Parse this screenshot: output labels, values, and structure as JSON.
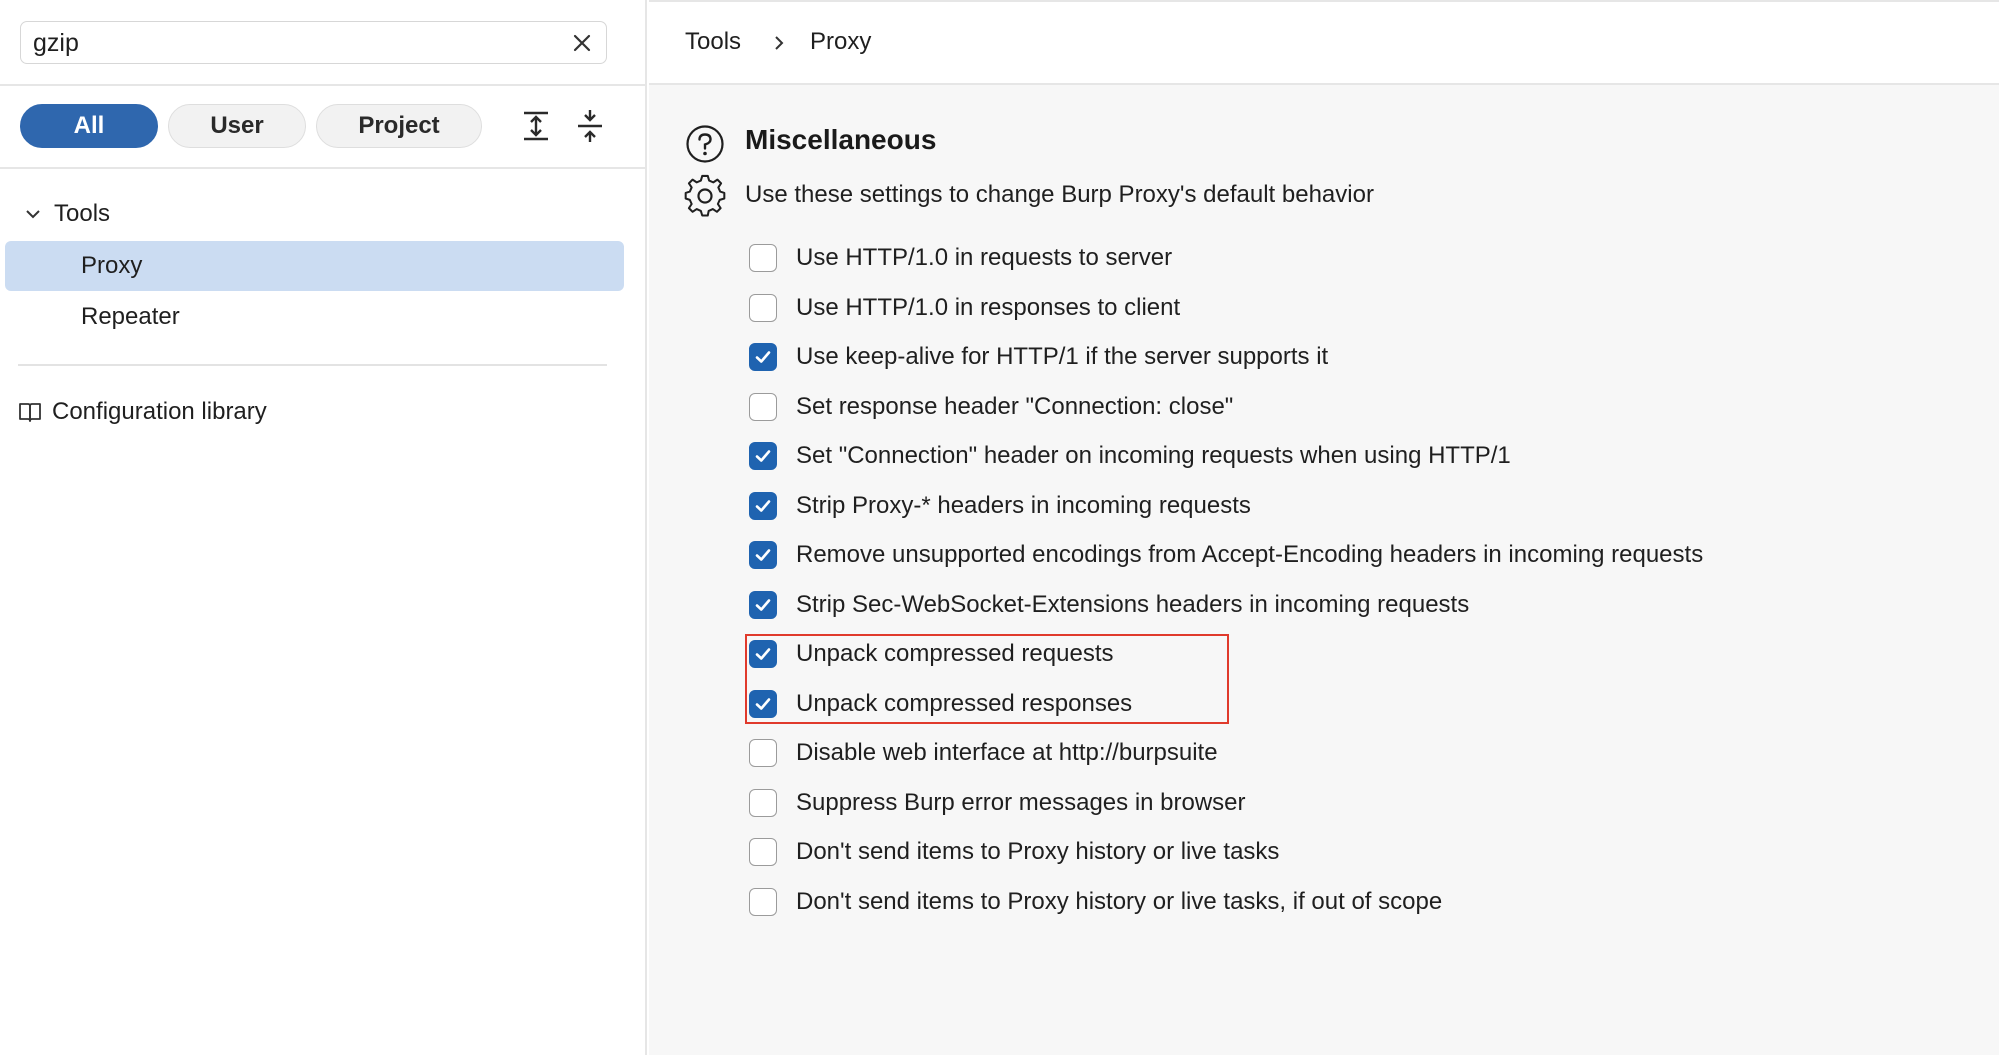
{
  "search": {
    "value": "gzip",
    "clear_icon": "close-icon"
  },
  "filters": {
    "all_label": "All",
    "user_label": "User",
    "project_label": "Project",
    "active": "All",
    "expand_icon": "expand-all-icon",
    "collapse_icon": "collapse-all-icon"
  },
  "tree": {
    "group_label": "Tools",
    "items": [
      {
        "label": "Proxy",
        "selected": true
      },
      {
        "label": "Repeater",
        "selected": false
      }
    ],
    "config_library_label": "Configuration library"
  },
  "breadcrumb": {
    "items": [
      "Tools",
      "Proxy"
    ]
  },
  "section": {
    "title": "Miscellaneous",
    "description": "Use these settings to change Burp Proxy's default behavior"
  },
  "options": [
    {
      "label": "Use HTTP/1.0 in requests to server",
      "checked": false
    },
    {
      "label": "Use HTTP/1.0 in responses to client",
      "checked": false
    },
    {
      "label": "Use keep-alive for HTTP/1 if the server supports it",
      "checked": true
    },
    {
      "label": "Set response header \"Connection: close\"",
      "checked": false
    },
    {
      "label": "Set \"Connection\" header on incoming requests when using HTTP/1",
      "checked": true
    },
    {
      "label": "Strip Proxy-* headers in incoming requests",
      "checked": true
    },
    {
      "label": "Remove unsupported encodings from Accept-Encoding headers in incoming requests",
      "checked": true
    },
    {
      "label": "Strip Sec-WebSocket-Extensions headers in incoming requests",
      "checked": true
    },
    {
      "label": "Unpack compressed requests",
      "checked": true
    },
    {
      "label": "Unpack compressed responses",
      "checked": true
    },
    {
      "label": "Disable web interface at http://burpsuite",
      "checked": false
    },
    {
      "label": "Suppress Burp error messages in browser",
      "checked": false
    },
    {
      "label": "Don't send items to Proxy history or live tasks",
      "checked": false
    },
    {
      "label": "Don't send items to Proxy history or live tasks, if out of scope",
      "checked": false
    }
  ],
  "colors": {
    "accent": "#1f63b0",
    "selected_row": "#cbdcf2",
    "highlight": "#e03a2c"
  }
}
